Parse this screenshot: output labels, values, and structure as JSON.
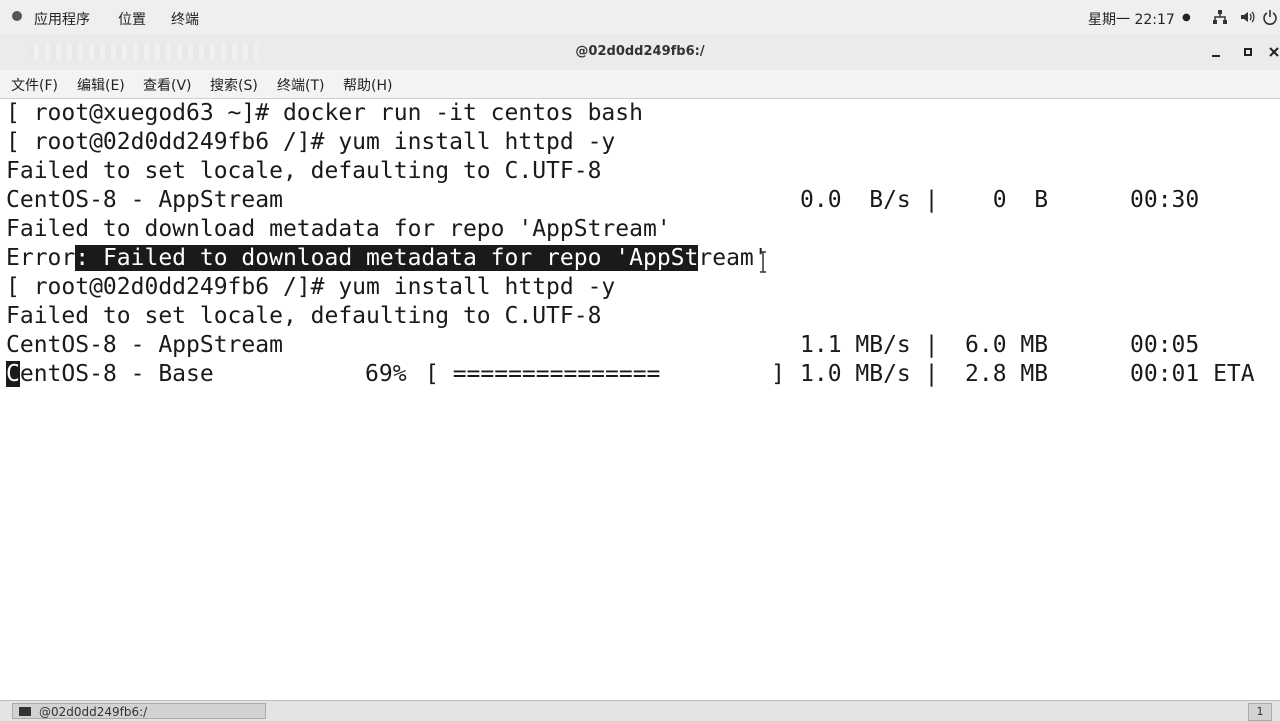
{
  "topbar": {
    "applications": "应用程序",
    "places": "位置",
    "terminal": "终端",
    "clock": "星期一 22:17",
    "status_dot": "●"
  },
  "window": {
    "title": "@02d0dd249fb6:/"
  },
  "menubar": {
    "items": [
      "文件(F)",
      "编辑(E)",
      "查看(V)",
      "搜索(S)",
      "终端(T)",
      "帮助(H)"
    ]
  },
  "terminal": {
    "lines": [
      "[ root@xuegod63 ~]# docker run -it centos bash",
      "[ root@02d0dd249fb6 /]# yum install httpd -y",
      "Failed to set locale, defaulting to C.UTF-8"
    ],
    "repo1": {
      "name": "CentOS-8 - AppStream",
      "speed": "0.0  B/s |",
      "size": "  0  B",
      "time": "00:30"
    },
    "fail_line": "Failed to download metadata for repo 'AppStream'",
    "error_prefix": "Error",
    "error_highlight": ": Failed to download metadata for repo 'AppSt",
    "error_rest": "ream'",
    "line_cmd2": "[ root@02d0dd249fb6 /]# yum install httpd -y",
    "line_locale2": "Failed to set locale, defaulting to C.UTF-8",
    "repo2": {
      "name": "CentOS-8 - AppStream",
      "speed": "1.1 MB/s |",
      "size": "6.0 MB",
      "time": "00:05"
    },
    "repo3": {
      "cursor_char": "C",
      "name_rest": "entOS-8 - Base",
      "percent": "69%",
      "bar": "[ ===============        ]",
      "speed": "1.0 MB/s |",
      "size": "2.8 MB",
      "time": "00:01 ETA"
    }
  },
  "taskbar": {
    "task_label": "@02d0dd249fb6:/",
    "pager": "1"
  }
}
